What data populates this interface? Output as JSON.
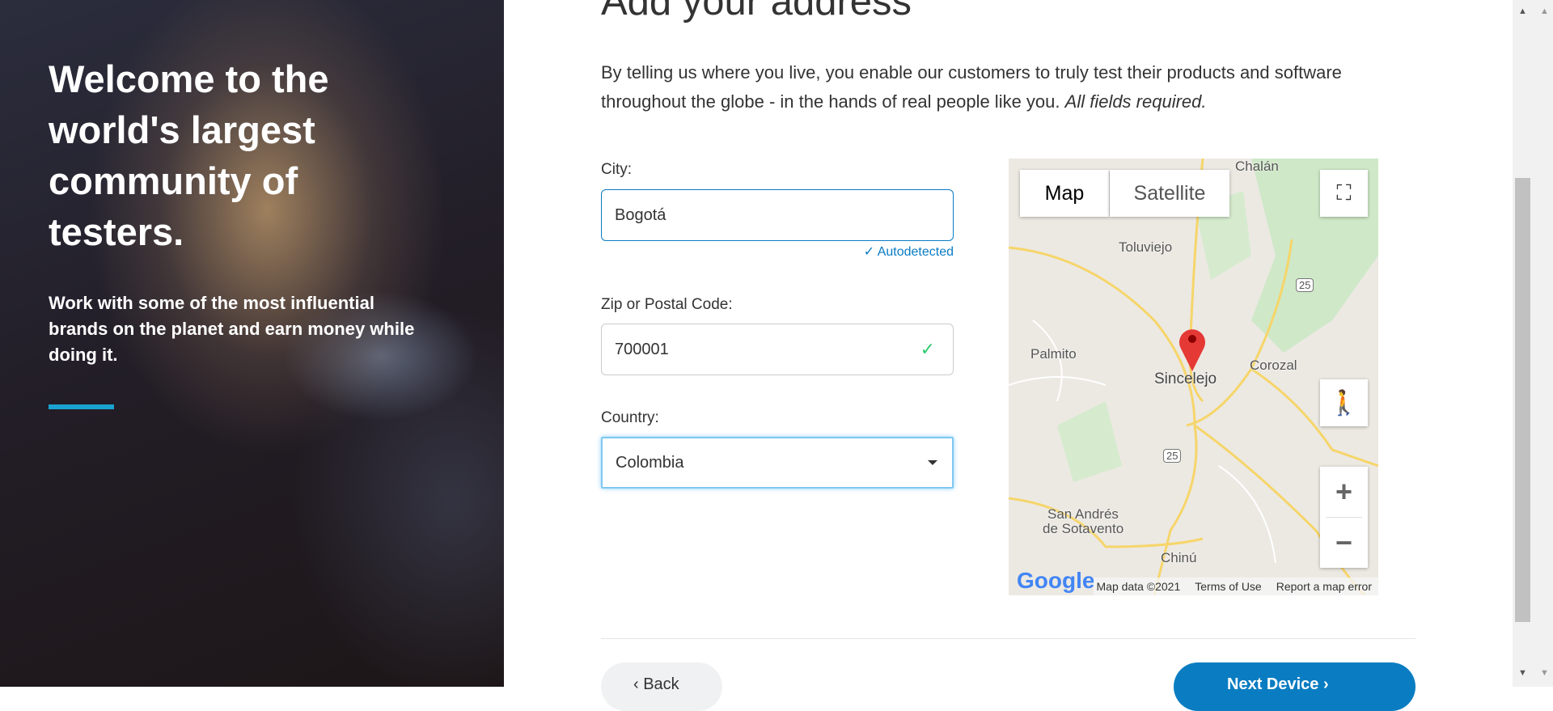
{
  "hero": {
    "title": "Welcome to the world's largest community of testers.",
    "subtitle": "Work with some of the most influential brands on the planet and earn money while doing it."
  },
  "main": {
    "title": "Add your address",
    "intro": "By telling us where you live, you enable our customers to truly test their products and software throughout the globe - in the hands of real people like you.",
    "intro_em": "All fields required."
  },
  "form": {
    "city": {
      "label": "City:",
      "value": "Bogotá",
      "status": "Autodetected"
    },
    "zip": {
      "label": "Zip or Postal Code:",
      "value": "700001"
    },
    "country": {
      "label": "Country:",
      "value": "Colombia"
    }
  },
  "map": {
    "map_tab": "Map",
    "satellite_tab": "Satellite",
    "places": [
      "Chalán",
      "Toluviejo",
      "Palmito",
      "Sincelejo",
      "Corozal",
      "San Andrés",
      "de Sotavento",
      "Chinú"
    ],
    "route": "25",
    "logo": "Google",
    "data": "Map data ©2021",
    "terms": "Terms of Use",
    "report": "Report a map error",
    "zoom_in": "+",
    "zoom_out": "−"
  },
  "nav": {
    "back": "Back",
    "next": "Next Device"
  },
  "colors": {
    "accent": "#0a7dc2",
    "hero_bar": "#1aa3d1",
    "success": "#2ecc71"
  }
}
